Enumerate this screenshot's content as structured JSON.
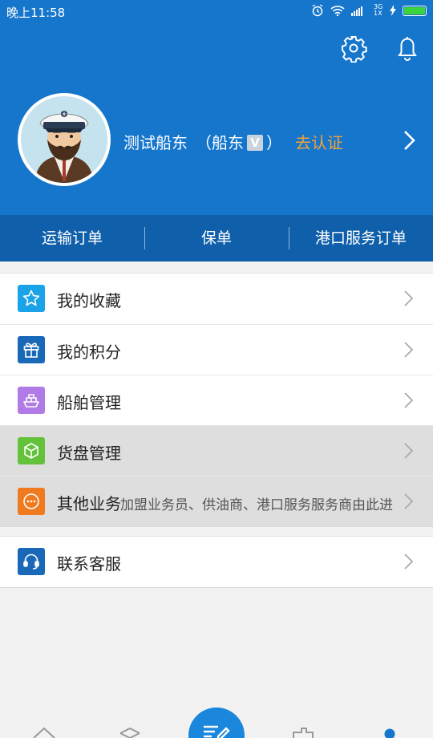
{
  "status_bar": {
    "time": "晚上11:58",
    "network": "3G 1X",
    "battery_color": "#3cd43c"
  },
  "header": {
    "bg_color": "#1576cc",
    "settings_icon": "gear-icon",
    "notification_icon": "bell-icon"
  },
  "profile": {
    "name": "测试船东",
    "role_open": "（船东",
    "role_badge": "V",
    "role_close": "）",
    "verify_label": "去认证",
    "verify_color": "#f3a33a"
  },
  "tabs": [
    {
      "label": "运输订单"
    },
    {
      "label": "保单"
    },
    {
      "label": "港口服务订单"
    }
  ],
  "menu_main": [
    {
      "label": "我的收藏",
      "icon": "star-icon",
      "color": "#1aa3e8"
    },
    {
      "label": "我的积分",
      "icon": "gift-icon",
      "color": "#1a68b8"
    },
    {
      "label": "船舶管理",
      "icon": "ship-icon",
      "color": "#b07be6"
    },
    {
      "label": "货盘管理",
      "icon": "box-icon",
      "color": "#64c23a"
    },
    {
      "label": "其他业务",
      "sub": "加盟业务员、供油商、港口服务服务商由此进",
      "icon": "more-dots-icon",
      "color": "#f07a20"
    }
  ],
  "menu_support": [
    {
      "label": "联系客服",
      "icon": "headset-icon",
      "color": "#1a68b8"
    }
  ],
  "bottom_nav": [
    "home-icon",
    "cargo-icon",
    "publish-icon",
    "ship-nav-icon",
    "profile-nav-icon"
  ]
}
